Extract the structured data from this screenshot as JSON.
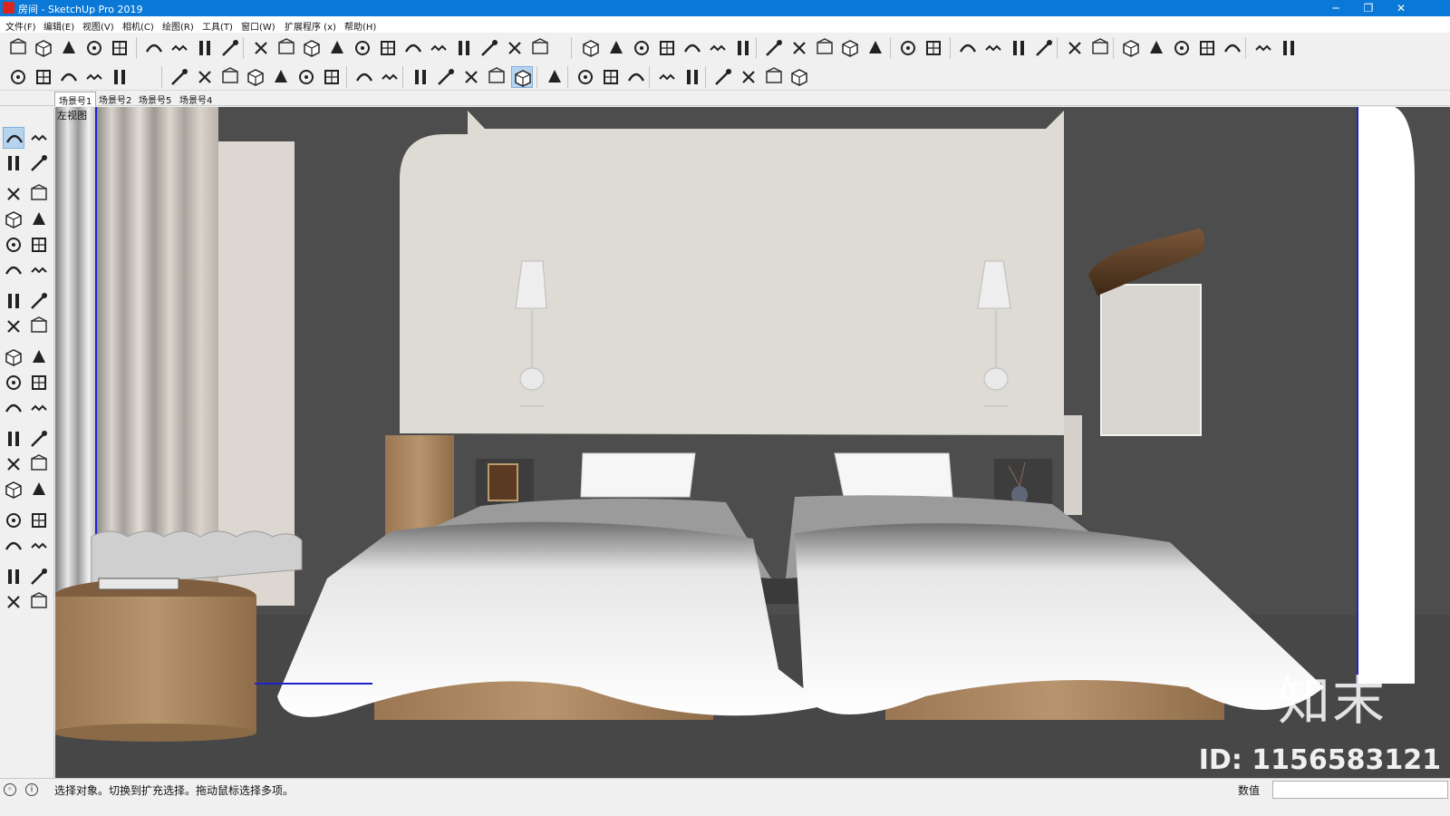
{
  "window": {
    "title": "房间 - SketchUp Pro 2019",
    "minimize": "─",
    "restore": "❐",
    "close": "✕"
  },
  "menu": [
    "文件(F)",
    "编辑(E)",
    "视图(V)",
    "相机(C)",
    "绘图(R)",
    "工具(T)",
    "窗口(W)",
    "扩展程序 (x)",
    "帮助(H)"
  ],
  "toolbar_icons_row1": [
    "walk-icon",
    "box-icon",
    "cube-icon",
    "hand-icon",
    "no-entry-icon",
    "stairs-icon",
    "column-icon",
    "slope-icon",
    "bars-icon",
    "flip-icon",
    "line-icon",
    "curve-icon",
    "bend-icon",
    "arc-icon",
    "rotate-icon",
    "wave-icon",
    "edge-icon",
    "join-icon",
    "layers-icon",
    "stack-icon",
    "door-icon",
    "cap-icon",
    "arch-icon",
    "chain-icon",
    "swoosh-icon",
    "swirl-icon",
    "blade-icon",
    "comb-icon",
    "pillars-icon",
    "triangle-icon",
    "dots-icon",
    "pillar-icon",
    "compass-icon",
    "brush-icon",
    "circle-plus-icon",
    "circle-minus-icon",
    "table-icon",
    "check-icon",
    "env-icon",
    "model-icon",
    "shapes-icon",
    "swap-icon",
    "measure-icon",
    "view-iso-icon",
    "view-top-icon",
    "view-front-icon",
    "view-right-icon",
    "settings-icon"
  ],
  "toolbar_icons_row2": [
    "component-icon",
    "book-icon",
    "house-icon",
    "house2-icon",
    "shop-icon",
    "table-lamp-icon",
    "ring-icon",
    "triangle-ruler-icon",
    "stool-icon",
    "sparkle-icon",
    "dome-icon",
    "sphere-icon",
    "section-icon",
    "shade-icon",
    "xray-icon",
    "back-edge-icon",
    "shaded-icon",
    "textured-icon",
    "monochrome-icon",
    "validate-icon",
    "teapot-icon",
    "teapot-hand-icon",
    "cloud-icon",
    "plane-icon",
    "plane-off-icon",
    "window-icon",
    "window2-icon",
    "window3-icon",
    "lock-icon"
  ],
  "scene_tabs": [
    "场景号1",
    "场景号2",
    "场景号5",
    "场景号4"
  ],
  "active_scene": "场景号1",
  "left_tools": [
    "select-arrow-icon",
    "component-cube-icon",
    "paint-bucket-icon",
    "eraser-icon",
    "pencil-icon",
    "freehand-icon",
    "rectangle-icon",
    "rotated-rect-icon",
    "circle-icon",
    "polygon-icon",
    "arc-icon",
    "pie-icon",
    "arc-3pt-icon",
    "arc-2pt-icon",
    "move-icon",
    "push-pull-icon",
    "rotate-icon",
    "follow-me-icon",
    "scale-icon",
    "offset-icon",
    "tape-measure-icon",
    "dimension-icon",
    "protractor-icon",
    "text-icon",
    "axes-icon",
    "3d-text-icon",
    "orbit-icon",
    "pan-icon",
    "zoom-icon",
    "zoom-window-icon",
    "zoom-extents-icon",
    "previous-icon",
    "position-camera-icon",
    "look-around-icon",
    "walk-icon",
    "section-plane-icon"
  ],
  "viewport": {
    "view_label": "左视图",
    "watermark_logo": "知末",
    "watermark_id": "ID: 1156583121"
  },
  "status": {
    "hint": "选择对象。切换到扩充选择。拖动鼠标选择多项。",
    "measurements_label": "数值",
    "measurements_value": ""
  },
  "colors": {
    "titlebar": "#0a78d7",
    "wall_dark": "#4c4c4c",
    "headboard_wall": "#dedad4",
    "bedding": "#f3f3f3",
    "wood": "#a88460"
  }
}
